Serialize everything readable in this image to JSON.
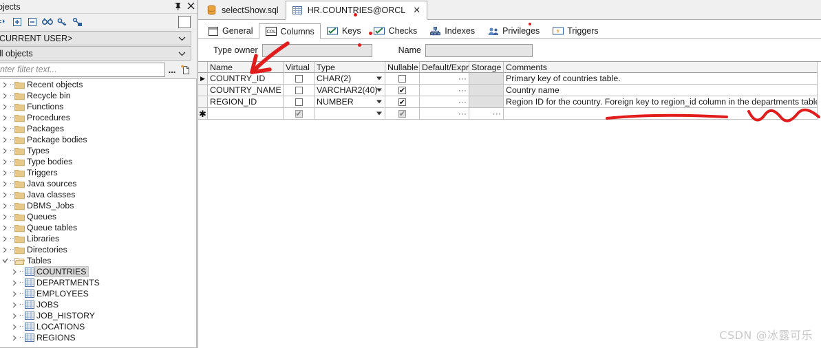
{
  "sidebar": {
    "title": "bjects",
    "pin_icon": "pin-icon",
    "close_icon": "close-icon",
    "toolbar_icons": [
      "collapse-all-icon",
      "expand-node-icon",
      "collapse-node-icon",
      "find-icon",
      "filter-key-icon",
      "filter-key-apply-icon"
    ],
    "schema_combo": "CURRENT USER>",
    "objtype_combo": "ll objects",
    "filter_placeholder": "nter filter text...",
    "filter_value": "",
    "ellipsis_label": "...",
    "tree": [
      {
        "label": "Recent objects",
        "icon": "folder-icon",
        "level": 1,
        "expandable": true,
        "selected": false
      },
      {
        "label": "Recycle bin",
        "icon": "folder-icon",
        "level": 1,
        "expandable": true,
        "selected": false
      },
      {
        "label": "Functions",
        "icon": "folder-icon",
        "level": 1,
        "expandable": true,
        "selected": false
      },
      {
        "label": "Procedures",
        "icon": "folder-icon",
        "level": 1,
        "expandable": true,
        "selected": false
      },
      {
        "label": "Packages",
        "icon": "folder-icon",
        "level": 1,
        "expandable": true,
        "selected": false
      },
      {
        "label": "Package bodies",
        "icon": "folder-icon",
        "level": 1,
        "expandable": true,
        "selected": false
      },
      {
        "label": "Types",
        "icon": "folder-icon",
        "level": 1,
        "expandable": true,
        "selected": false
      },
      {
        "label": "Type bodies",
        "icon": "folder-icon",
        "level": 1,
        "expandable": true,
        "selected": false
      },
      {
        "label": "Triggers",
        "icon": "folder-icon",
        "level": 1,
        "expandable": true,
        "selected": false
      },
      {
        "label": "Java sources",
        "icon": "folder-icon",
        "level": 1,
        "expandable": true,
        "selected": false
      },
      {
        "label": "Java classes",
        "icon": "folder-icon",
        "level": 1,
        "expandable": true,
        "selected": false
      },
      {
        "label": "DBMS_Jobs",
        "icon": "folder-icon",
        "level": 1,
        "expandable": true,
        "selected": false
      },
      {
        "label": "Queues",
        "icon": "folder-icon",
        "level": 1,
        "expandable": true,
        "selected": false
      },
      {
        "label": "Queue tables",
        "icon": "folder-icon",
        "level": 1,
        "expandable": true,
        "selected": false
      },
      {
        "label": "Libraries",
        "icon": "folder-icon",
        "level": 1,
        "expandable": true,
        "selected": false
      },
      {
        "label": "Directories",
        "icon": "folder-icon",
        "level": 1,
        "expandable": true,
        "selected": false
      },
      {
        "label": "Tables",
        "icon": "folder-open-icon",
        "level": 1,
        "expandable": true,
        "expanded": true,
        "selected": false
      },
      {
        "label": "COUNTRIES",
        "icon": "table-icon",
        "level": 2,
        "expandable": true,
        "selected": true
      },
      {
        "label": "DEPARTMENTS",
        "icon": "table-icon",
        "level": 2,
        "expandable": true,
        "selected": false
      },
      {
        "label": "EMPLOYEES",
        "icon": "table-icon",
        "level": 2,
        "expandable": true,
        "selected": false
      },
      {
        "label": "JOBS",
        "icon": "table-icon",
        "level": 2,
        "expandable": true,
        "selected": false
      },
      {
        "label": "JOB_HISTORY",
        "icon": "table-icon",
        "level": 2,
        "expandable": true,
        "selected": false
      },
      {
        "label": "LOCATIONS",
        "icon": "table-icon",
        "level": 2,
        "expandable": true,
        "selected": false
      },
      {
        "label": "REGIONS",
        "icon": "table-icon",
        "level": 2,
        "expandable": true,
        "selected": false
      }
    ]
  },
  "editor_tabs": [
    {
      "label": "selectShow.sql",
      "icon": "sql-file-icon",
      "active": false,
      "closable": false
    },
    {
      "label": "HR.COUNTRIES@ORCL",
      "icon": "table-icon",
      "active": true,
      "closable": true,
      "close_label": "✕"
    }
  ],
  "detail_tabs": [
    {
      "label": "General",
      "icon": "general-icon",
      "active": false
    },
    {
      "label": "Columns",
      "icon": "columns-icon",
      "active": true
    },
    {
      "label": "Keys",
      "icon": "keys-icon",
      "active": false
    },
    {
      "label": "Checks",
      "icon": "checks-icon",
      "active": false
    },
    {
      "label": "Indexes",
      "icon": "indexes-icon",
      "active": false
    },
    {
      "label": "Privileges",
      "icon": "privileges-icon",
      "active": false
    },
    {
      "label": "Triggers",
      "icon": "triggers-icon",
      "active": false
    }
  ],
  "form": {
    "type_owner_label": "Type owner",
    "type_owner_value": "",
    "name_label": "Name",
    "name_value": ""
  },
  "grid": {
    "headers": [
      "Name",
      "Virtual",
      "Type",
      "Nullable",
      "Default/Expr.",
      "Storage",
      "Comments"
    ],
    "rows": [
      {
        "selector": "▶",
        "name": "COUNTRY_ID",
        "virtual": false,
        "virtual_disabled": false,
        "type": "CHAR(2)",
        "nullable": false,
        "nullable_disabled": false,
        "default": "···",
        "storage": "",
        "storage_disabled": true,
        "comments": "Primary key of countries table."
      },
      {
        "selector": "",
        "name": "COUNTRY_NAME",
        "virtual": false,
        "virtual_disabled": false,
        "type": "VARCHAR2(40)",
        "nullable": true,
        "nullable_disabled": false,
        "default": "···",
        "storage": "",
        "storage_disabled": true,
        "comments": "Country name"
      },
      {
        "selector": "",
        "name": "REGION_ID",
        "virtual": false,
        "virtual_disabled": false,
        "type": "NUMBER",
        "nullable": true,
        "nullable_disabled": false,
        "default": "···",
        "storage": "",
        "storage_disabled": true,
        "comments": "Region ID for the country. Foreign key to region_id column in the departments table."
      },
      {
        "selector": "✱",
        "name": "",
        "virtual": true,
        "virtual_disabled": true,
        "type": "",
        "nullable": true,
        "nullable_disabled": true,
        "default": "···",
        "storage": "···",
        "storage_disabled": false,
        "comments": ""
      }
    ]
  },
  "annotations": {
    "arrow_color": "#e11c1c",
    "underline_color": "#e11c1c",
    "squiggle_color": "#e11c1c"
  },
  "watermark": "CSDN @冰露可乐",
  "colors": {
    "accent": "#2a6099",
    "panel_bg": "#f0f0f0",
    "grid_line": "#bfbfbf",
    "folder": "#e8c989"
  }
}
